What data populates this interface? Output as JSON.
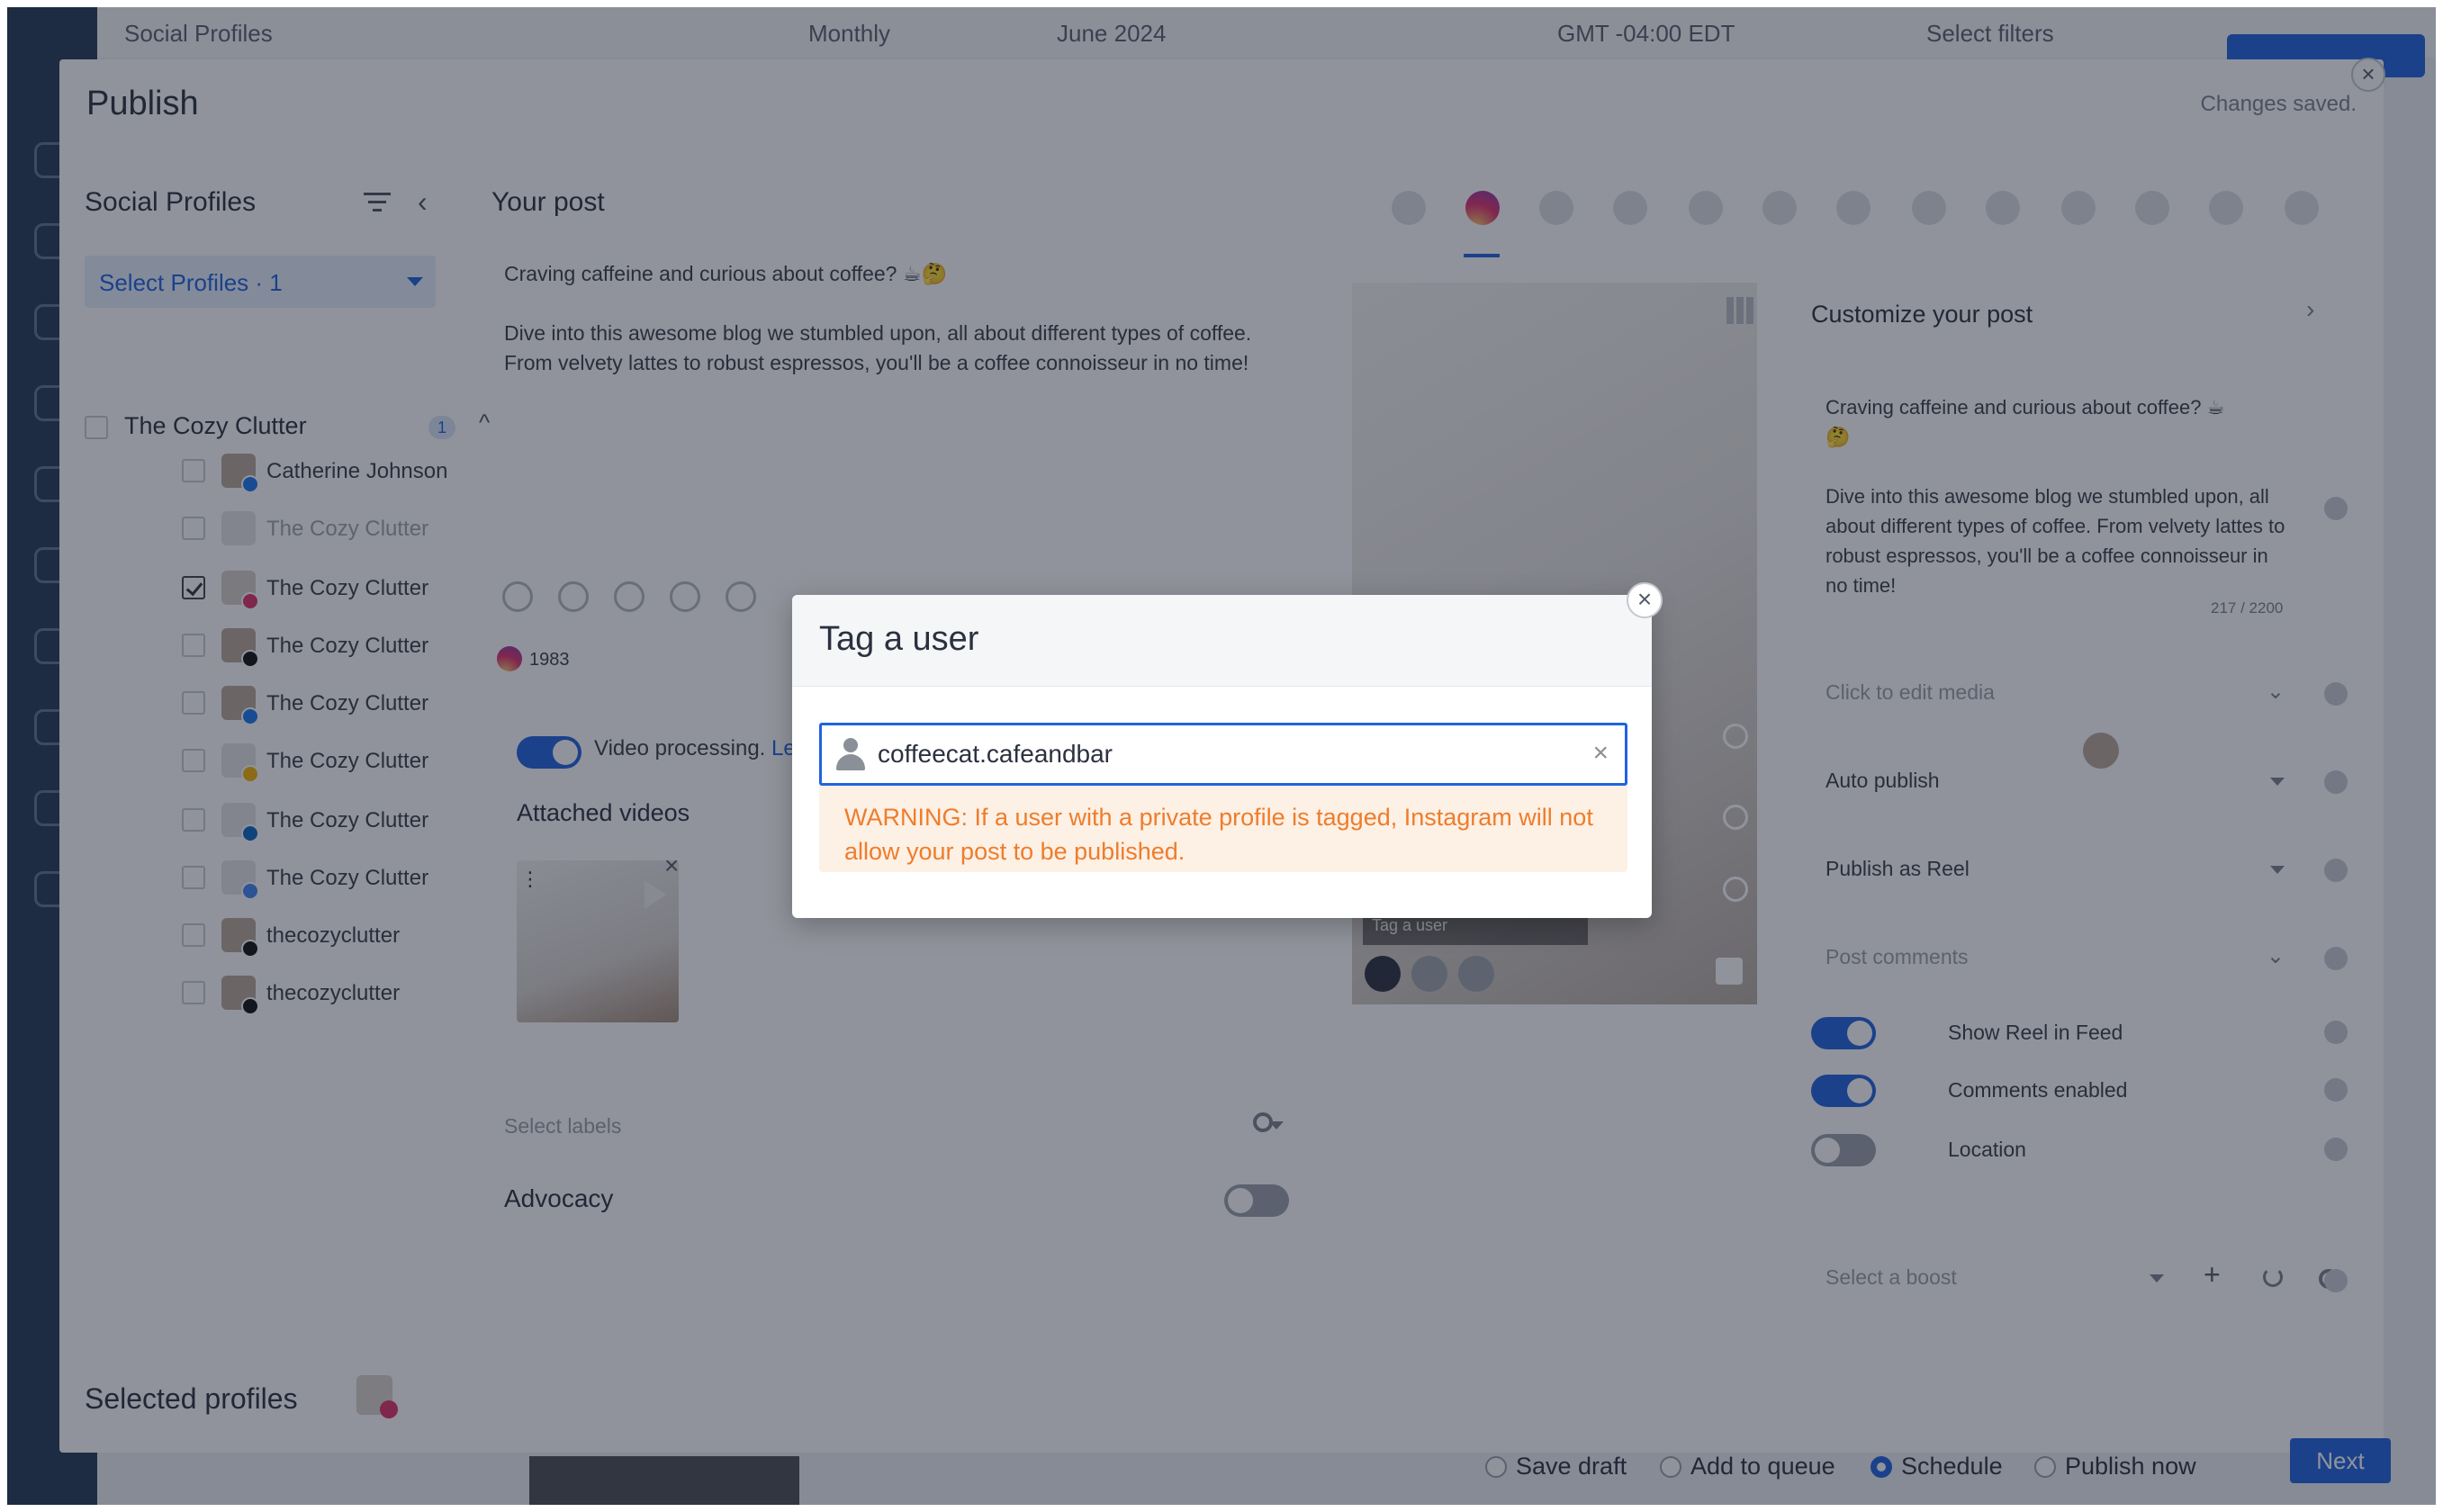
{
  "background": {
    "top_items": [
      "Social Profiles",
      "Monthly",
      "June 2024",
      "GMT -04:00 EDT",
      "Select filters"
    ]
  },
  "publish": {
    "title": "Publish",
    "status": "Changes saved.",
    "close_glyph": "×",
    "social_profiles": {
      "title": "Social Profiles",
      "select_label": "Select Profiles · 1",
      "collapse_glyph": "‹",
      "group": {
        "name": "The Cozy Clutter",
        "badge": "1",
        "caret_glyph": "^"
      },
      "profiles": [
        {
          "name": "Catherine Johnson",
          "network": "facebook",
          "checked": false,
          "muted": false
        },
        {
          "name": "The Cozy Clutter",
          "network": "none",
          "checked": false,
          "muted": true
        },
        {
          "name": "The Cozy Clutter",
          "network": "instagram",
          "checked": true,
          "muted": false
        },
        {
          "name": "The Cozy Clutter",
          "network": "x",
          "checked": false,
          "muted": false
        },
        {
          "name": "The Cozy Clutter",
          "network": "facebook",
          "checked": false,
          "muted": false
        },
        {
          "name": "The Cozy Clutter",
          "network": "google-business",
          "checked": false,
          "muted": false
        },
        {
          "name": "The Cozy Clutter",
          "network": "linkedin",
          "checked": false,
          "muted": false
        },
        {
          "name": "The Cozy Clutter",
          "network": "google-business",
          "checked": false,
          "muted": false
        },
        {
          "name": "thecozyclutter",
          "network": "threads",
          "checked": false,
          "muted": false
        },
        {
          "name": "thecozyclutter",
          "network": "tiktok",
          "checked": false,
          "muted": false
        }
      ],
      "selected_profiles_label": "Selected profiles"
    },
    "your_post": {
      "title": "Your post",
      "text": "Craving caffeine and curious about coffee? ☕🤔\n\nDive into this awesome blog we stumbled upon, all about different types of coffee. From velvety lattes to robust espressos, you'll be a coffee connoisseur in no time!",
      "ig_count": "1983",
      "video_processing_label": "Video processing.",
      "video_processing_link": "Le",
      "attached_videos_title": "Attached videos",
      "thumb_menu_glyph": "⋮",
      "thumb_remove_glyph": "×",
      "labels_placeholder": "Select labels",
      "advocacy_label": "Advocacy"
    },
    "networks": [
      "facebook",
      "instagram",
      "linkedin",
      "x",
      "youtube",
      "google-business",
      "mastodon",
      "pinterest",
      "tiktok",
      "bluesky",
      "threads",
      "tumblr",
      "other"
    ],
    "active_network": "instagram",
    "preview": {
      "tag_bar_text": "Tag a user"
    },
    "customize": {
      "title": "Customize your post",
      "arrow_glyph": "›",
      "text": "Craving caffeine and curious about coffee? ☕\n🤔\n\nDive into this awesome blog we stumbled upon, all about different types of coffee. From velvety lattes to robust espressos, you'll be a coffee connoisseur in no time!",
      "char_count": "217 / 2200",
      "edit_media_label": "Click to edit media",
      "auto_publish_label": "Auto publish",
      "publish_as_label": "Publish as Reel",
      "post_comments_label": "Post comments",
      "show_reel_label": "Show Reel in Feed",
      "comments_enabled_label": "Comments enabled",
      "location_label": "Location",
      "boost_placeholder": "Select a boost",
      "plus_glyph": "+",
      "chevron_glyph": "⌄"
    },
    "footer": {
      "save_draft": "Save draft",
      "add_to_queue": "Add to queue",
      "schedule": "Schedule",
      "publish_now": "Publish now",
      "selected_option": "Schedule",
      "next": "Next"
    }
  },
  "tag_dialog": {
    "title": "Tag a user",
    "close_glyph": "×",
    "input_value": "coffeecat.cafeandbar",
    "clear_glyph": "×",
    "warning": "WARNING: If a user with a private profile is tagged, Instagram will not allow your post to be published."
  },
  "colors": {
    "primary": "#1f63e0",
    "warning_text": "#ee7d2b",
    "warning_bg": "#fdf0e5",
    "overlay": "rgba(22,30,46,0.48)"
  }
}
